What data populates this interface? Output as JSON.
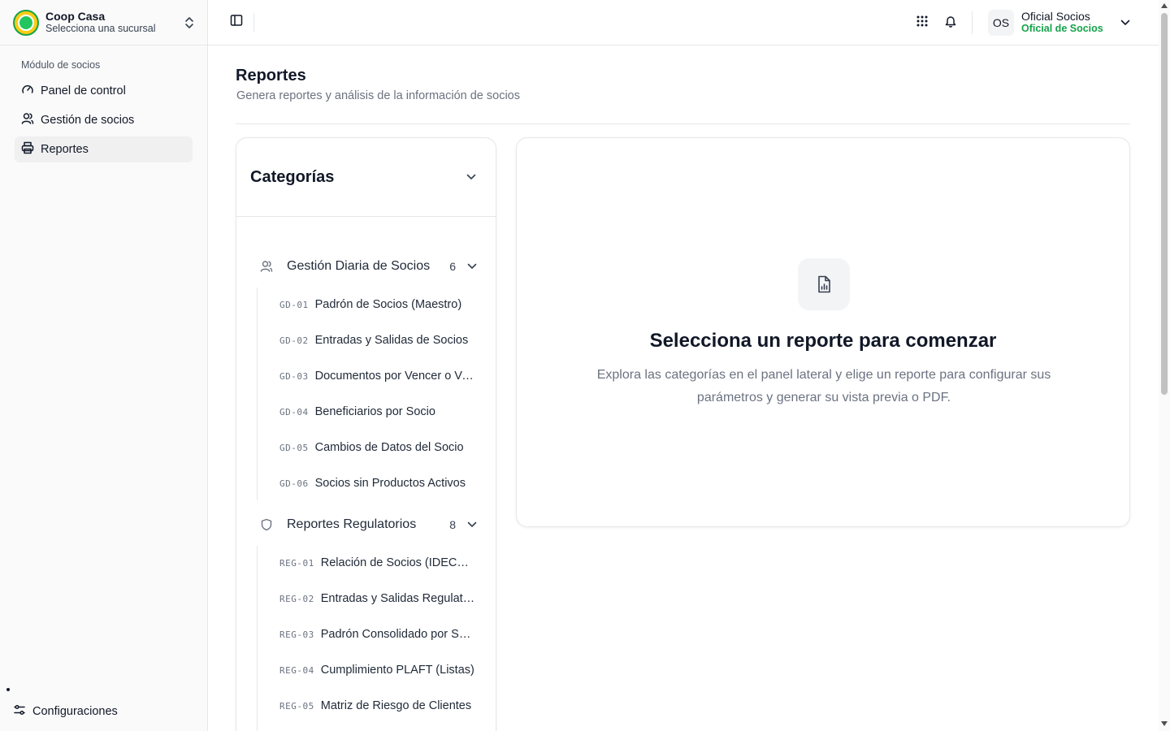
{
  "brand": {
    "name": "Coop Casa",
    "subtitle": "Selecciona una sucursal"
  },
  "sidebar": {
    "section_label": "Módulo de socios",
    "items": [
      {
        "label": "Panel de control",
        "icon": "gauge-icon"
      },
      {
        "label": "Gestión de socios",
        "icon": "users-icon"
      },
      {
        "label": "Reportes",
        "icon": "printer-icon",
        "active": true
      }
    ],
    "settings_label": "Configuraciones"
  },
  "topbar": {
    "user_initials": "OS",
    "user_name": "Oficial Socios",
    "user_role": "Oficial de Socios"
  },
  "page": {
    "title": "Reportes",
    "subtitle": "Genera reportes y análisis de la información de socios"
  },
  "categories": {
    "title": "Categorías",
    "groups": [
      {
        "title": "Gestión Diaria de Socios",
        "count": "6",
        "icon": "users-icon",
        "items": [
          {
            "code": "GD-01",
            "name": "Padrón de Socios (Maestro)"
          },
          {
            "code": "GD-02",
            "name": "Entradas y Salidas de Socios"
          },
          {
            "code": "GD-03",
            "name": "Documentos por Vencer o Vencidos"
          },
          {
            "code": "GD-04",
            "name": "Beneficiarios por Socio"
          },
          {
            "code": "GD-05",
            "name": "Cambios de Datos del Socio"
          },
          {
            "code": "GD-06",
            "name": "Socios sin Productos Activos"
          }
        ]
      },
      {
        "title": "Reportes Regulatorios",
        "count": "8",
        "icon": "shield-icon",
        "items": [
          {
            "code": "REG-01",
            "name": "Relación de Socios (IDECOOP)"
          },
          {
            "code": "REG-02",
            "name": "Entradas y Salidas Regulatorias"
          },
          {
            "code": "REG-03",
            "name": "Padrón Consolidado por Sucursal"
          },
          {
            "code": "REG-04",
            "name": "Cumplimiento PLAFT (Listas)"
          },
          {
            "code": "REG-05",
            "name": "Matriz de Riesgo de Clientes"
          }
        ]
      }
    ]
  },
  "empty_state": {
    "title": "Selecciona un reporte para comenzar",
    "text": "Explora las categorías en el panel lateral y elige un reporte para configurar sus parámetros y generar su vista previa o PDF."
  },
  "colors": {
    "accent_green": "#16a34a",
    "border": "#e5e7eb",
    "muted_text": "#6b7280"
  }
}
